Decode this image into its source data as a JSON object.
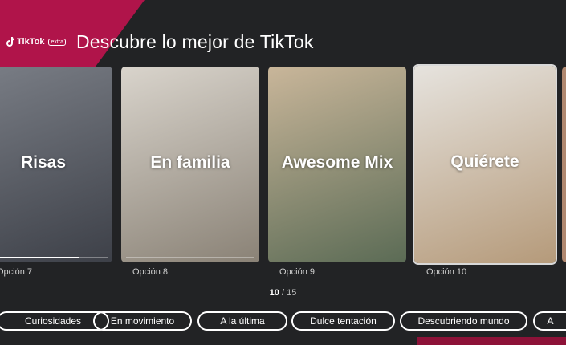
{
  "brand": {
    "name": "TikTok",
    "tag": "extra"
  },
  "page_title": "Descubre lo mejor de TikTok",
  "cards": [
    {
      "label": "Risas",
      "option": "Opción 7",
      "colors": [
        "#7a7e86",
        "#3d4048"
      ]
    },
    {
      "label": "En familia",
      "option": "Opción 8",
      "colors": [
        "#d9d4cc",
        "#8a8276"
      ]
    },
    {
      "label": "Awesome Mix",
      "option": "Opción 9",
      "colors": [
        "#c9b69a",
        "#5b6b55"
      ]
    },
    {
      "label": "Quiérete",
      "option": "Opción 10",
      "colors": [
        "#e6e3de",
        "#b59a7a"
      ]
    }
  ],
  "pager": {
    "current": "10",
    "total": "/ 15"
  },
  "chips": [
    "Curiosidades",
    "En movimiento",
    "A la última",
    "Dulce tentación",
    "Descubriendo mundo",
    "A"
  ],
  "colors": {
    "accent": "#b0144a",
    "background": "#222325"
  }
}
